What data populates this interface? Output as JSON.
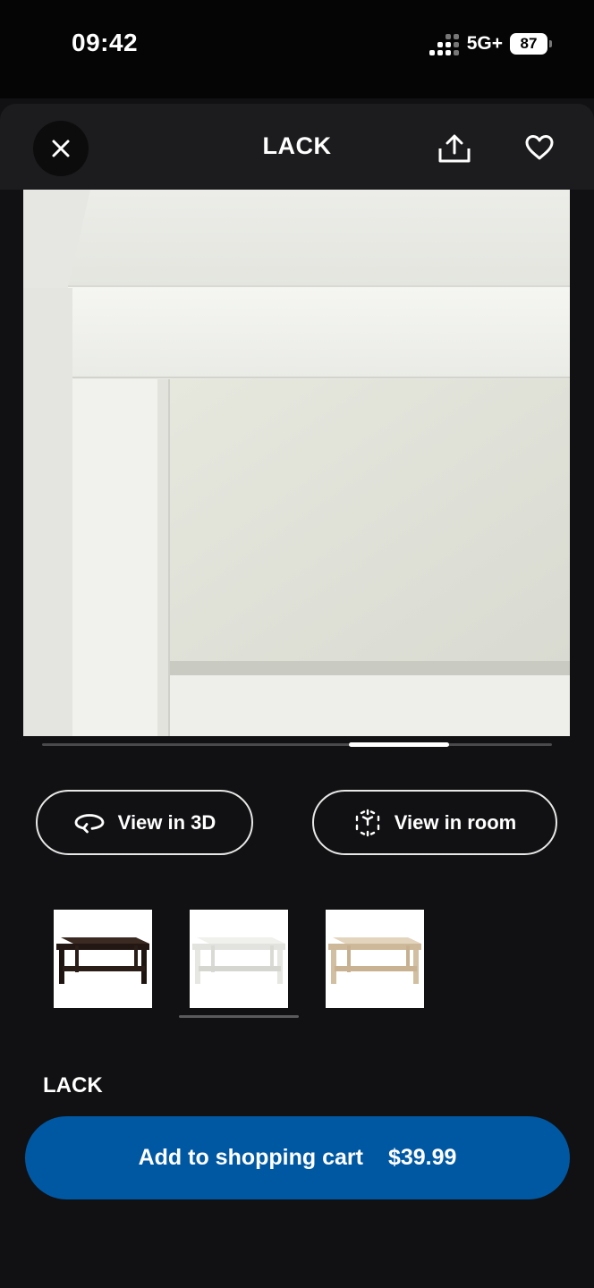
{
  "status_bar": {
    "time": "09:42",
    "network": "5G+",
    "battery": "87"
  },
  "header": {
    "title": "LACK",
    "close_icon": "close-icon",
    "share_icon": "share-icon",
    "favorite_icon": "heart-icon"
  },
  "gallery": {
    "image_count_indicator": "carousel",
    "current_page_fraction": 0.6
  },
  "actions": {
    "view_3d_label": "View in 3D",
    "view_room_label": "View in room"
  },
  "variants": [
    {
      "name": "black-brown",
      "color": "#2a1d17",
      "selected": false
    },
    {
      "name": "white",
      "color": "#f2f2ee",
      "selected": true
    },
    {
      "name": "white stained oak effect",
      "color": "#d8c7ad",
      "selected": false
    }
  ],
  "product": {
    "name": "LACK"
  },
  "cart": {
    "label": "Add to shopping cart",
    "price": "$39.99"
  },
  "colors": {
    "accent": "#0058a3",
    "background": "#111113",
    "header": "#1c1c1e"
  }
}
